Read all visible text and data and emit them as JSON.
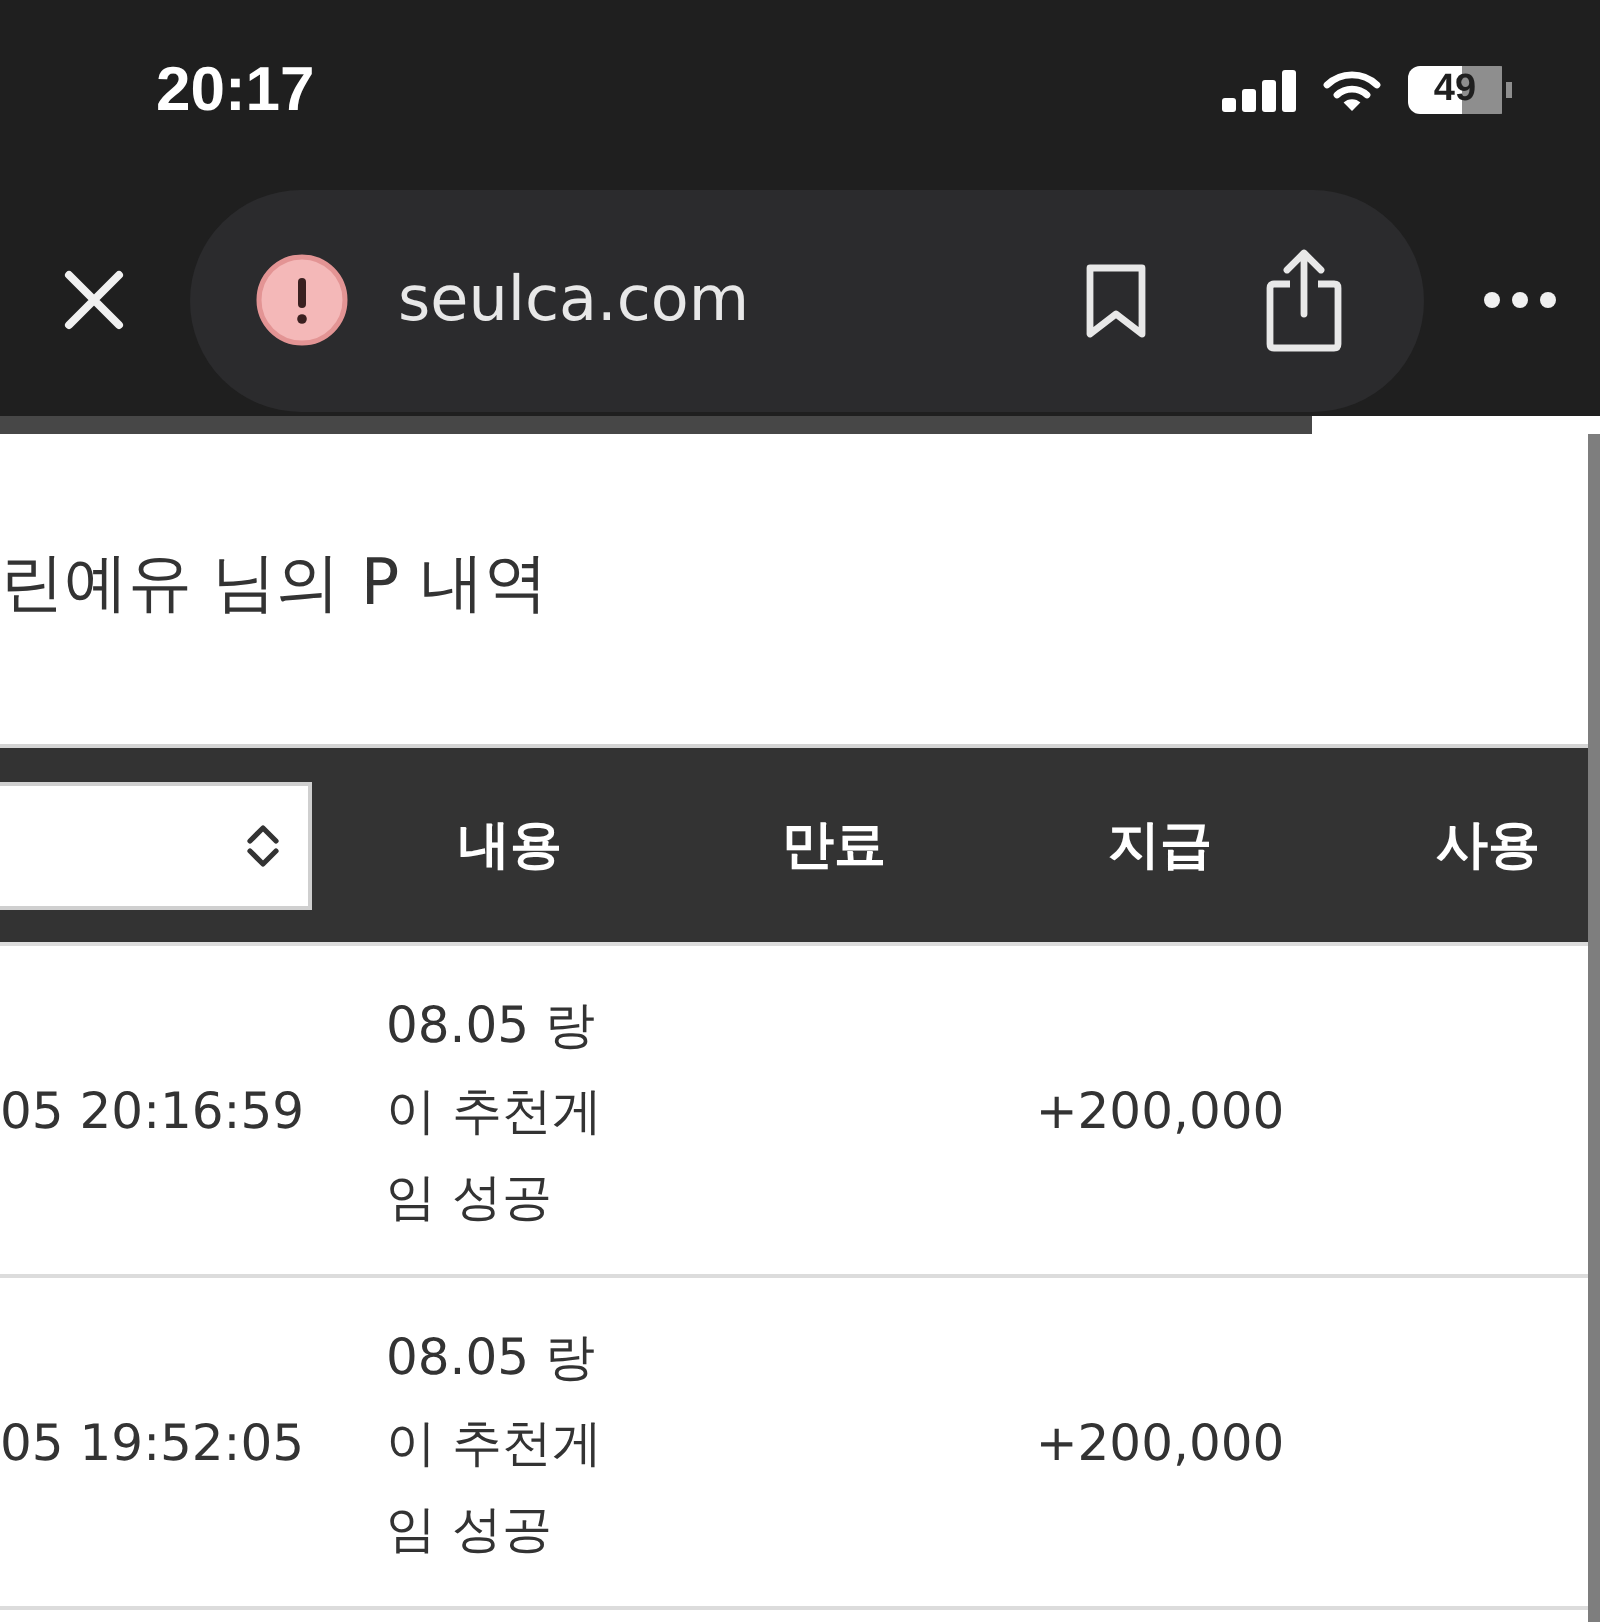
{
  "status_bar": {
    "time": "20:17",
    "battery": "49"
  },
  "browser_toolbar": {
    "url": "seulca.com"
  },
  "loading_bar": {
    "level": 0.82
  },
  "page": {
    "title": "린예유 님의 P 내역"
  },
  "table": {
    "columns": [
      "내용",
      "만료",
      "지급",
      "사용"
    ],
    "rows": [
      {
        "timestamp": "05 20:16:59",
        "description": "08.05 랑이 추천게임 성공",
        "granted": "+200,000"
      },
      {
        "timestamp": "05 19:52:05",
        "description": "08.05 랑이 추천게임 성공",
        "granted": "+200,000"
      }
    ]
  }
}
